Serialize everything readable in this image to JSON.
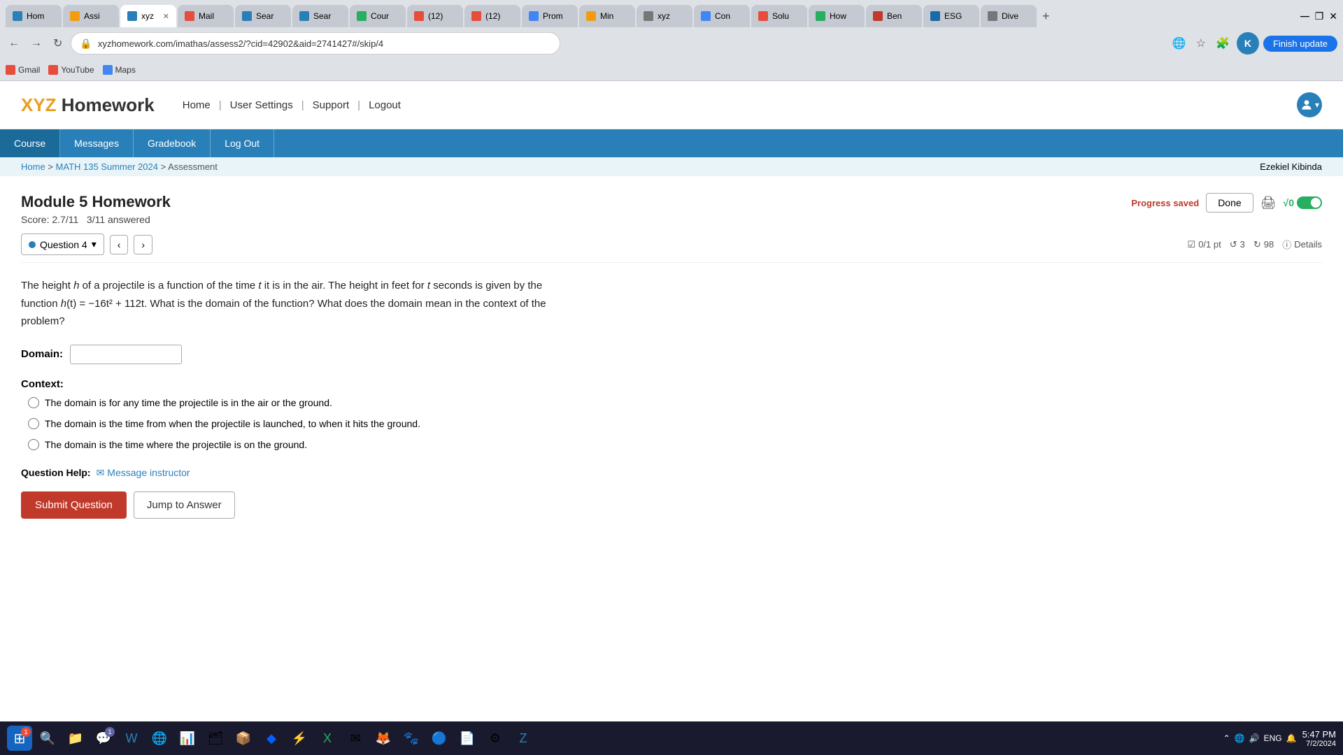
{
  "browser": {
    "url": "xyzhomework.com/imathas/assess2/?cid=42902&aid=2741427#/skip/4",
    "tabs": [
      {
        "id": "home",
        "label": "Hom",
        "favicon_color": "#2980b9",
        "active": false
      },
      {
        "id": "assi",
        "label": "Assi",
        "favicon_color": "#f39c12",
        "active": false
      },
      {
        "id": "xyz",
        "label": "xyz",
        "favicon_color": "#2980b9",
        "active": true
      },
      {
        "id": "mail",
        "label": "Mail",
        "favicon_color": "#e74c3c",
        "active": false
      },
      {
        "id": "sear1",
        "label": "Sear",
        "favicon_color": "#2980b9",
        "active": false
      },
      {
        "id": "sear2",
        "label": "Sear",
        "favicon_color": "#2980b9",
        "active": false
      },
      {
        "id": "cour",
        "label": "Cour",
        "favicon_color": "#27ae60",
        "active": false
      },
      {
        "id": "yt1",
        "label": "(12)",
        "favicon_color": "#e74c3c",
        "active": false
      },
      {
        "id": "yt2",
        "label": "(12)",
        "favicon_color": "#e74c3c",
        "active": false
      },
      {
        "id": "gpro",
        "label": "Prom",
        "favicon_color": "#4285f4",
        "active": false
      },
      {
        "id": "min",
        "label": "Min",
        "favicon_color": "#f39c12",
        "active": false
      },
      {
        "id": "xyz2",
        "label": "xyz",
        "favicon_color": "#777",
        "active": false
      },
      {
        "id": "gcon",
        "label": "Con",
        "favicon_color": "#4285f4",
        "active": false
      },
      {
        "id": "solu",
        "label": "Solu",
        "favicon_color": "#e74c3c",
        "active": false
      },
      {
        "id": "how",
        "label": "How",
        "favicon_color": "#27ae60",
        "active": false
      },
      {
        "id": "ben",
        "label": "Ben",
        "favicon_color": "#c0392b",
        "active": false
      },
      {
        "id": "esg",
        "label": "ESG",
        "favicon_color": "#1a6aaa",
        "active": false
      },
      {
        "id": "dive",
        "label": "Dive",
        "favicon_color": "#777",
        "active": false
      }
    ],
    "bookmarks": [
      {
        "label": "Gmail",
        "favicon_color": "#e74c3c"
      },
      {
        "label": "YouTube",
        "favicon_color": "#e74c3c"
      },
      {
        "label": "Maps",
        "favicon_color": "#4285f4"
      }
    ],
    "finish_update": "Finish update"
  },
  "site": {
    "logo_xyz": "XYZ",
    "logo_hw": " Homework",
    "nav": {
      "home": "Home",
      "user_settings": "User Settings",
      "support": "Support",
      "logout": "Logout"
    }
  },
  "course_nav": {
    "items": [
      "Course",
      "Messages",
      "Gradebook",
      "Log Out"
    ]
  },
  "breadcrumb": {
    "home": "Home",
    "course": "MATH 135 Summer 2024",
    "current": "Assessment",
    "user": "Ezekiel Kibinda"
  },
  "homework": {
    "title": "Module 5 Homework",
    "score": "Score: 2.7/11",
    "answered": "3/11 answered",
    "progress_saved": "Progress saved",
    "done_label": "Done",
    "v0_label": "√0"
  },
  "question": {
    "number": "Question 4",
    "points": "0/1 pt",
    "retries": "3",
    "submissions": "98",
    "details": "Details",
    "text_part1": "The height ",
    "h_var": "h",
    "text_part2": " of a projectile is a function of the time ",
    "t_var": "t",
    "text_part3": " it is in the air. The height in feet for ",
    "t_var2": "t",
    "text_part4": " seconds is given by the function ",
    "formula": "h(t) = −16t² + 112t",
    "text_part5": ". What is the domain of the function? What does the domain mean in the context of the problem?",
    "domain_label": "Domain:",
    "domain_placeholder": "",
    "context_label": "Context:",
    "options": [
      {
        "id": "opt1",
        "text": "The domain is for any time the projectile is in the air or the ground."
      },
      {
        "id": "opt2",
        "text": "The domain is the time from when the projectile is launched, to when it hits the ground."
      },
      {
        "id": "opt3",
        "text": "The domain is the time where the projectile is on the ground."
      }
    ],
    "help_label": "Question Help:",
    "message_instructor": "Message instructor",
    "submit_label": "Submit Question",
    "jump_label": "Jump to Answer"
  },
  "taskbar": {
    "time": "5:47 PM",
    "date": "7/2/2024",
    "language": "ENG",
    "start_badge": "1"
  }
}
